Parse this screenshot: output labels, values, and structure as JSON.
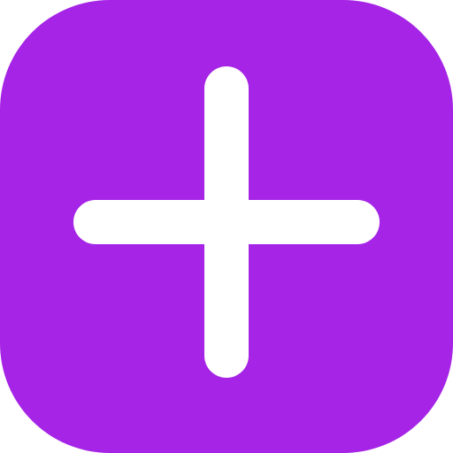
{
  "app_icon": {
    "icon": "plus-icon",
    "colors": {
      "background": "#a524e6",
      "glyph": "#ffffff"
    }
  }
}
